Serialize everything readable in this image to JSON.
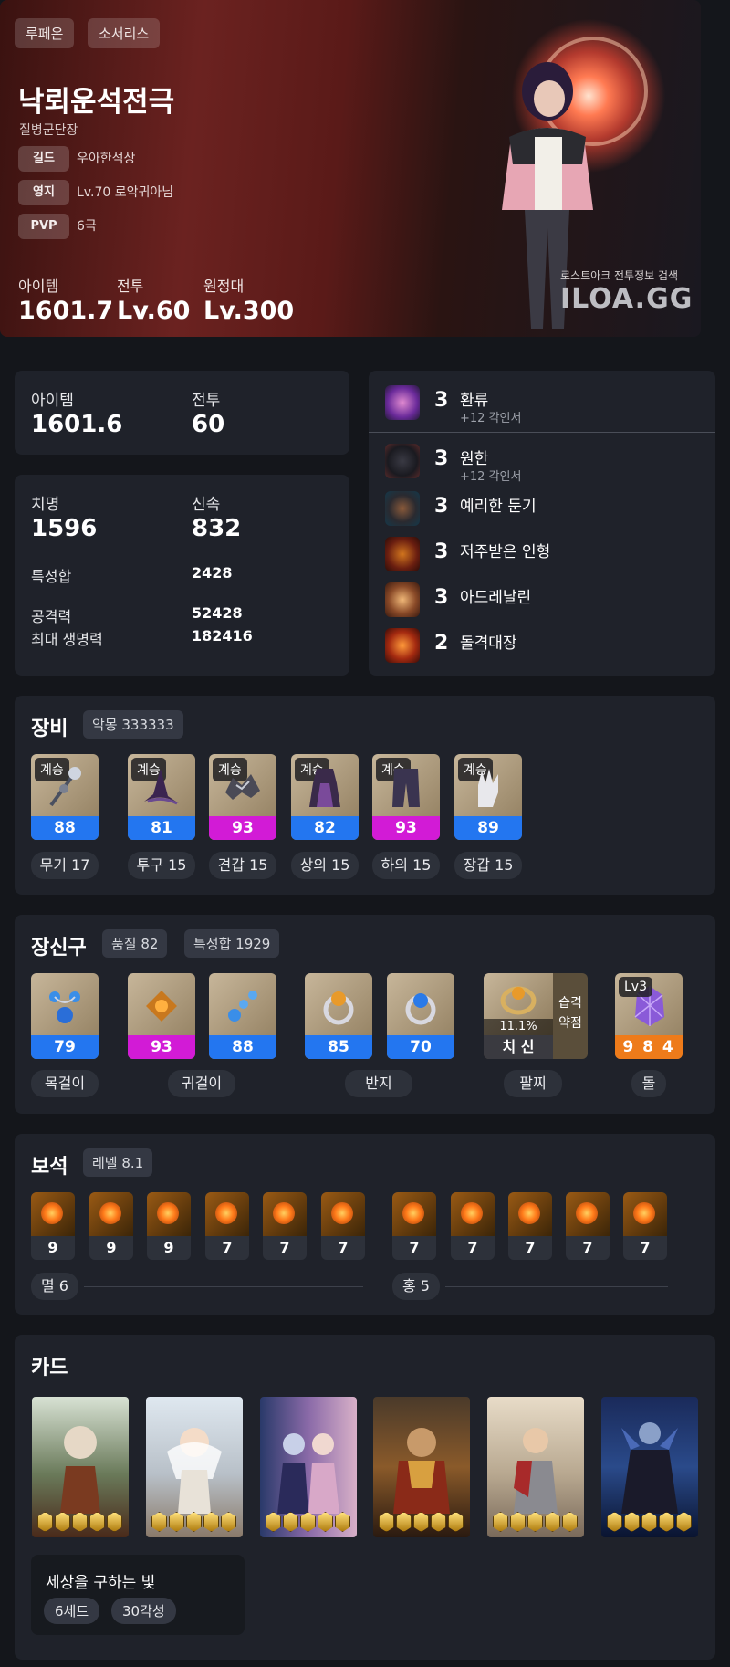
{
  "hero": {
    "tags": [
      "루페온",
      "소서리스"
    ],
    "name": "낙뢰운석전극",
    "title": "질병군단장",
    "rows": [
      {
        "label": "길드",
        "value": "우아한석상"
      },
      {
        "label": "영지",
        "value": "Lv.70 로악귀아님"
      },
      {
        "label": "PVP",
        "value": "6극"
      }
    ],
    "stats": [
      {
        "label": "아이템",
        "value": "1601.7"
      },
      {
        "label": "전투",
        "value": "Lv.60"
      },
      {
        "label": "원정대",
        "value": "Lv.300"
      }
    ],
    "brand_small": "로스트아크 전투정보 검색",
    "brand_big": "ILOA.GG"
  },
  "level_card": {
    "item_label": "아이템",
    "item_value": "1601.6",
    "combat_label": "전투",
    "combat_value": "60"
  },
  "stats_card": {
    "crit_label": "치명",
    "crit_value": "1596",
    "swift_label": "신속",
    "swift_value": "832",
    "total_label": "특성합",
    "total_value": "2428",
    "atk_label": "공격력",
    "atk_value": "52428",
    "hp_label": "최대 생명력",
    "hp_value": "182416"
  },
  "engravings": [
    {
      "level": "3",
      "name": "환류",
      "sub": "+12 각인서",
      "icon": "vortex-icon",
      "color": "#7a3fb0"
    },
    {
      "level": "3",
      "name": "원한",
      "sub": "+12 각인서",
      "icon": "demon-icon",
      "color": "#5a2a2a"
    },
    {
      "level": "3",
      "name": "예리한 둔기",
      "sub": "",
      "icon": "mace-icon",
      "color": "#4a3a2a"
    },
    {
      "level": "3",
      "name": "저주받은 인형",
      "sub": "",
      "icon": "doll-icon",
      "color": "#7a2a18"
    },
    {
      "level": "3",
      "name": "아드레날린",
      "sub": "",
      "icon": "adrenaline-icon",
      "color": "#8a4a28"
    },
    {
      "level": "2",
      "name": "돌격대장",
      "sub": "",
      "icon": "charge-icon",
      "color": "#8a2a14"
    }
  ],
  "equipment": {
    "title": "장비",
    "set_chip": "악몽 333333",
    "badge": "계승",
    "items": [
      {
        "quality": "88",
        "label": "무기 17",
        "tier": "blue",
        "icon": "staff-icon"
      },
      {
        "quality": "81",
        "label": "투구 15",
        "tier": "blue",
        "icon": "hat-icon"
      },
      {
        "quality": "93",
        "label": "견갑 15",
        "tier": "mag",
        "icon": "shoulder-icon"
      },
      {
        "quality": "82",
        "label": "상의 15",
        "tier": "blue",
        "icon": "robe-icon"
      },
      {
        "quality": "93",
        "label": "하의 15",
        "tier": "mag",
        "icon": "pants-icon"
      },
      {
        "quality": "89",
        "label": "장갑 15",
        "tier": "blue",
        "icon": "glove-icon"
      }
    ]
  },
  "accessories": {
    "title": "장신구",
    "quality_chip": "품질 82",
    "stat_chip": "특성합 1929",
    "items": [
      {
        "quality": "79",
        "tier": "blue",
        "icon": "necklace-icon"
      },
      {
        "quality": "93",
        "tier": "mag",
        "icon": "earring-icon"
      },
      {
        "quality": "88",
        "tier": "blue",
        "icon": "earring-icon"
      },
      {
        "quality": "85",
        "tier": "blue",
        "icon": "ring-icon"
      },
      {
        "quality": "70",
        "tier": "blue",
        "icon": "ring-icon"
      }
    ],
    "groups": [
      "목걸이",
      "귀걸이",
      "반지",
      "팔찌",
      "돌"
    ],
    "bracelet": {
      "percent": "11.1%",
      "stats": "치 신",
      "effect1": "습격",
      "effect2": "약점"
    },
    "stone": {
      "badge": "Lv3",
      "value": "9 8 4"
    }
  },
  "gems": {
    "title": "보석",
    "level_chip": "레벨 8.1",
    "left": [
      "9",
      "9",
      "9",
      "7",
      "7",
      "7"
    ],
    "right": [
      "7",
      "7",
      "7",
      "7",
      "7"
    ],
    "left_label": "멸 6",
    "right_label": "홍 5"
  },
  "cards": {
    "title": "카드",
    "set_name": "세상을 구하는 빛",
    "set_chip": "6세트",
    "awaken_chip": "30각성"
  }
}
